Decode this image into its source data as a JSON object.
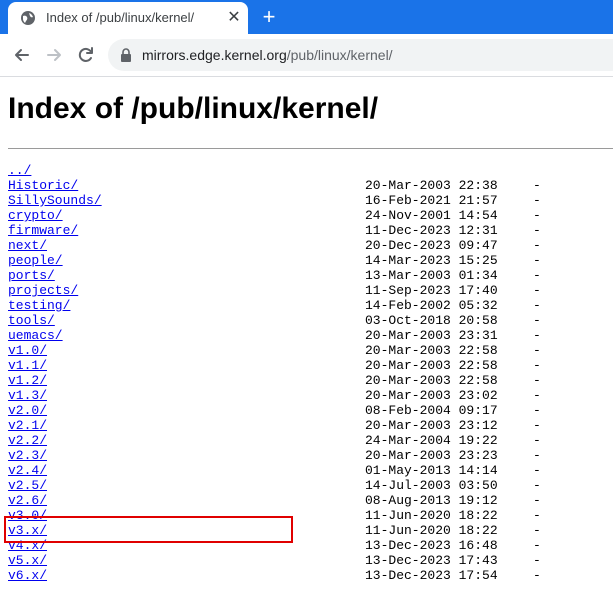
{
  "browser": {
    "tab_title": "Index of /pub/linux/kernel/",
    "url_host": "mirrors.edge.kernel.org",
    "url_path": "/pub/linux/kernel/"
  },
  "page": {
    "title": "Index of /pub/linux/kernel/",
    "entries": [
      {
        "name": "../",
        "date": "",
        "size": ""
      },
      {
        "name": "Historic/",
        "date": "20-Mar-2003 22:38",
        "size": "-"
      },
      {
        "name": "SillySounds/",
        "date": "16-Feb-2021 21:57",
        "size": "-"
      },
      {
        "name": "crypto/",
        "date": "24-Nov-2001 14:54",
        "size": "-"
      },
      {
        "name": "firmware/",
        "date": "11-Dec-2023 12:31",
        "size": "-"
      },
      {
        "name": "next/",
        "date": "20-Dec-2023 09:47",
        "size": "-"
      },
      {
        "name": "people/",
        "date": "14-Mar-2023 15:25",
        "size": "-"
      },
      {
        "name": "ports/",
        "date": "13-Mar-2003 01:34",
        "size": "-"
      },
      {
        "name": "projects/",
        "date": "11-Sep-2023 17:40",
        "size": "-"
      },
      {
        "name": "testing/",
        "date": "14-Feb-2002 05:32",
        "size": "-"
      },
      {
        "name": "tools/",
        "date": "03-Oct-2018 20:58",
        "size": "-"
      },
      {
        "name": "uemacs/",
        "date": "20-Mar-2003 23:31",
        "size": "-"
      },
      {
        "name": "v1.0/",
        "date": "20-Mar-2003 22:58",
        "size": "-"
      },
      {
        "name": "v1.1/",
        "date": "20-Mar-2003 22:58",
        "size": "-"
      },
      {
        "name": "v1.2/",
        "date": "20-Mar-2003 22:58",
        "size": "-"
      },
      {
        "name": "v1.3/",
        "date": "20-Mar-2003 23:02",
        "size": "-"
      },
      {
        "name": "v2.0/",
        "date": "08-Feb-2004 09:17",
        "size": "-"
      },
      {
        "name": "v2.1/",
        "date": "20-Mar-2003 23:12",
        "size": "-"
      },
      {
        "name": "v2.2/",
        "date": "24-Mar-2004 19:22",
        "size": "-"
      },
      {
        "name": "v2.3/",
        "date": "20-Mar-2003 23:23",
        "size": "-"
      },
      {
        "name": "v2.4/",
        "date": "01-May-2013 14:14",
        "size": "-"
      },
      {
        "name": "v2.5/",
        "date": "14-Jul-2003 03:50",
        "size": "-"
      },
      {
        "name": "v2.6/",
        "date": "08-Aug-2013 19:12",
        "size": "-"
      },
      {
        "name": "v3.0/",
        "date": "11-Jun-2020 18:22",
        "size": "-"
      },
      {
        "name": "v3.x/",
        "date": "11-Jun-2020 18:22",
        "size": "-"
      },
      {
        "name": "v4.x/",
        "date": "13-Dec-2023 16:48",
        "size": "-"
      },
      {
        "name": "v5.x/",
        "date": "13-Dec-2023 17:43",
        "size": "-"
      },
      {
        "name": "v6.x/",
        "date": "13-Dec-2023 17:54",
        "size": "-"
      }
    ]
  },
  "colors": {
    "tabstrip": "#1a73e8",
    "link": "#0000ee",
    "highlight_border": "#e00000"
  },
  "icons": {
    "favicon": "globe-icon",
    "close": "close-icon",
    "new_tab": "plus-icon",
    "back": "arrow-left-icon",
    "forward": "arrow-right-icon",
    "reload": "reload-icon",
    "lock": "lock-icon"
  }
}
